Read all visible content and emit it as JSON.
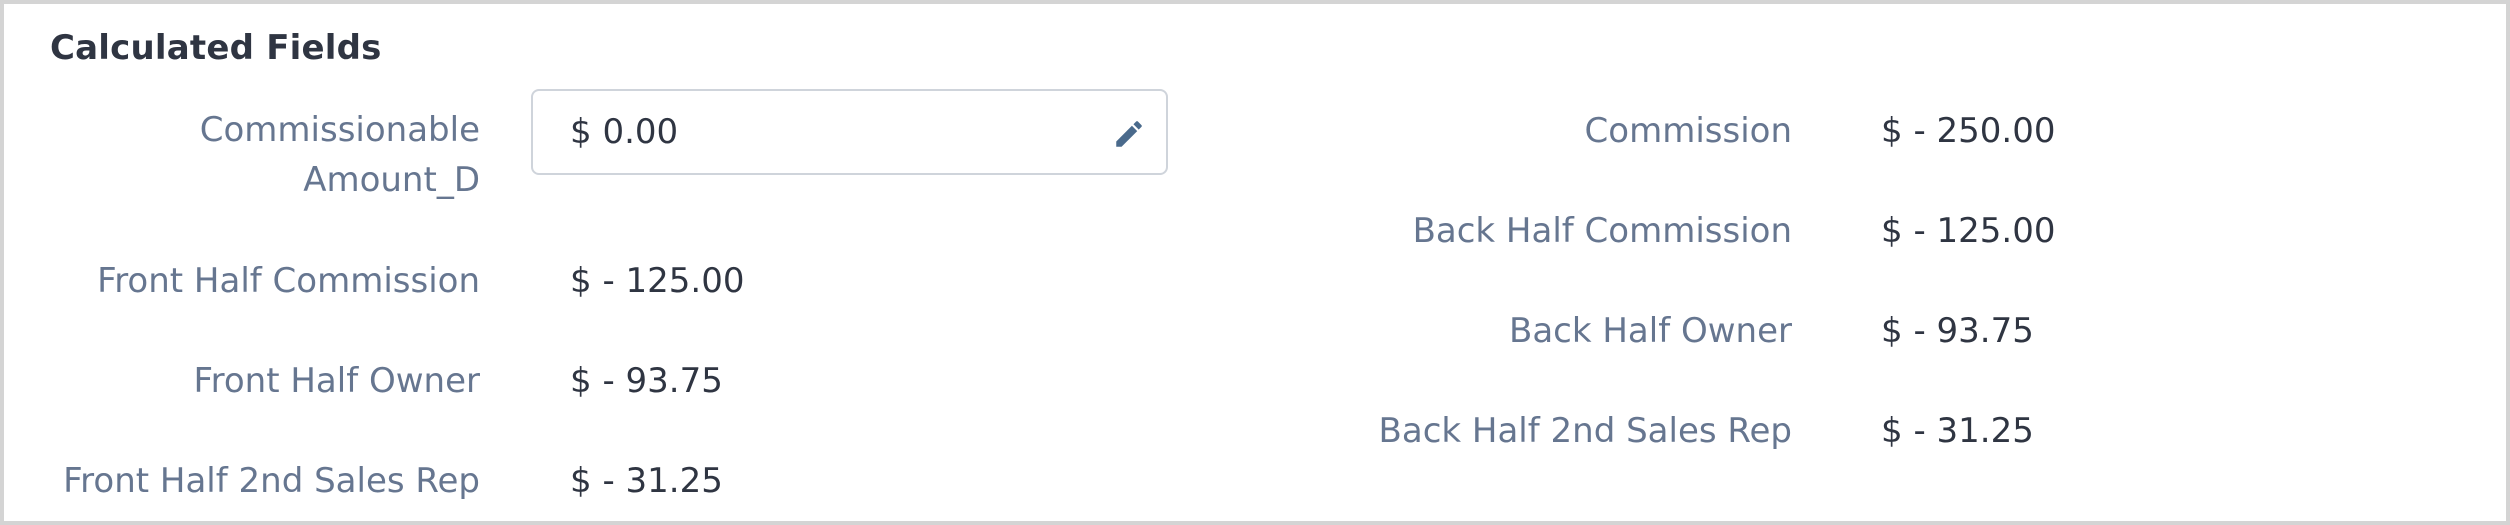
{
  "section": {
    "title": "Calculated Fields"
  },
  "left_fields": [
    {
      "label_line1": "Commissionable",
      "label_line2": "Amount_D",
      "value": "$ 0.00",
      "editable": true,
      "edit_icon": "pencil-icon"
    },
    {
      "label": "Front Half Commission",
      "value": "$ - 125.00"
    },
    {
      "label": "Front Half Owner",
      "value": "$ - 93.75"
    },
    {
      "label": "Front Half 2nd Sales Rep",
      "value": "$ - 31.25"
    }
  ],
  "right_fields": [
    {
      "label": "Commission",
      "value": "$ - 250.00"
    },
    {
      "label": "Back Half Commission",
      "value": "$ - 125.00"
    },
    {
      "label": "Back Half Owner",
      "value": "$ - 93.75"
    },
    {
      "label": "Back Half 2nd Sales Rep",
      "value": "$ - 31.25"
    }
  ],
  "colors": {
    "label": "#667690",
    "value": "#2f3542",
    "border": "#d4d4d4",
    "input_border": "#cfd4db",
    "icon": "#4a6a8c"
  }
}
